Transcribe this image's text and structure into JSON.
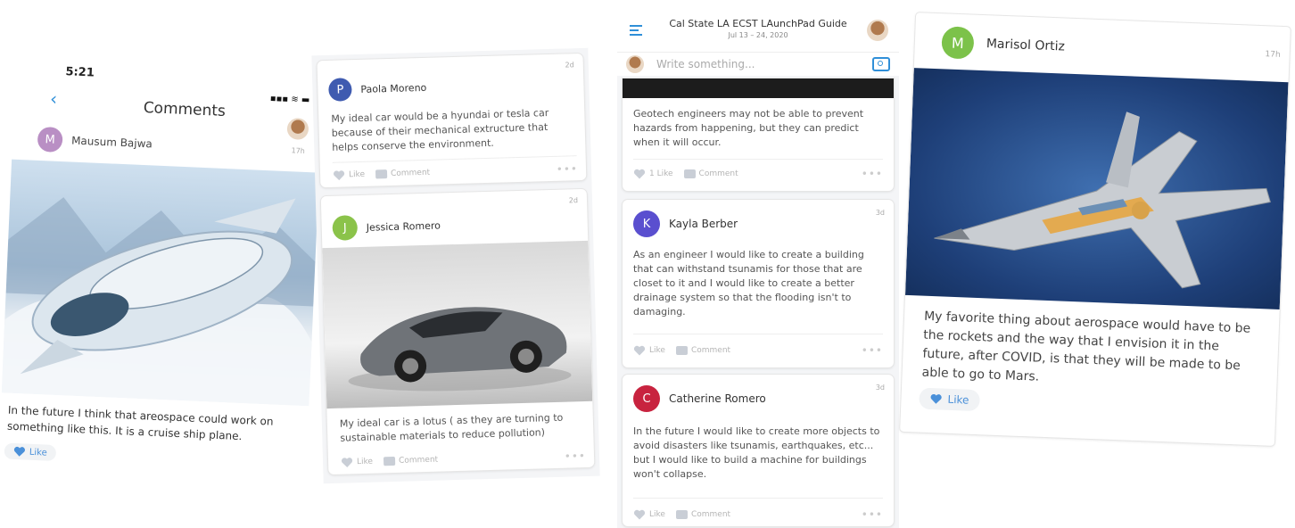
{
  "panel1": {
    "time": "5:21",
    "title": "Comments",
    "author": "Mausum Bajwa",
    "avatar_letter": "M",
    "age": "17h",
    "caption": "In the future I think that areospace could work on something like this. It is a cruise ship plane.",
    "like_label": "Like"
  },
  "panel2": {
    "post1": {
      "author": "Paola Moreno",
      "avatar_letter": "P",
      "age": "2d",
      "body": "My ideal car would be a hyundai or tesla car because of their mechanical extructure that helps conserve the environment.",
      "like": "Like",
      "comment": "Comment"
    },
    "post2": {
      "author": "Jessica Romero",
      "avatar_letter": "J",
      "age": "2d",
      "body": "My ideal car is a lotus ( as they are turning to sustainable materials to reduce pollution)",
      "like": "Like",
      "comment": "Comment"
    }
  },
  "panel3": {
    "header_title": "Cal State LA ECST LAunchPad Guide",
    "header_dates": "Jul 13 – 24, 2020",
    "compose_placeholder": "Write something...",
    "post0": {
      "body": "Geotech engineers may not be able to prevent hazards from happening, but they can predict when it will occur.",
      "like": "1 Like",
      "comment": "Comment"
    },
    "post1": {
      "author": "Kayla Berber",
      "avatar_letter": "K",
      "age": "3d",
      "body": "As an engineer I would like to create a building that can withstand tsunamis for those that are closet to it and I would like to create a better drainage system so that the flooding isn't to damaging.",
      "like": "Like",
      "comment": "Comment"
    },
    "post2": {
      "author": "Catherine Romero",
      "avatar_letter": "C",
      "age": "3d",
      "body": "In the future I would like to create more objects to avoid disasters like tsunamis, earthquakes, etc... but I would like to build a machine for buildings won't collapse.",
      "like": "Like",
      "comment": "Comment"
    }
  },
  "panel4": {
    "author": "Marisol Ortiz",
    "avatar_letter": "M",
    "age": "17h",
    "caption": "My favorite thing about aerospace would have to be the rockets and the way that I envision it in the future, after COVID, is that they will be made to be able to go to Mars.",
    "like_label": "Like"
  },
  "colors": {
    "accent_blue": "#2f8fd8",
    "heart_blue": "#4a90d9",
    "avatar_mausum": "#b98fc4",
    "avatar_paola": "#3f5bb0",
    "avatar_jessica": "#8bc34a",
    "avatar_kayla": "#5a4fcf",
    "avatar_catherine": "#c8233f",
    "avatar_marisol": "#7cc24a"
  }
}
